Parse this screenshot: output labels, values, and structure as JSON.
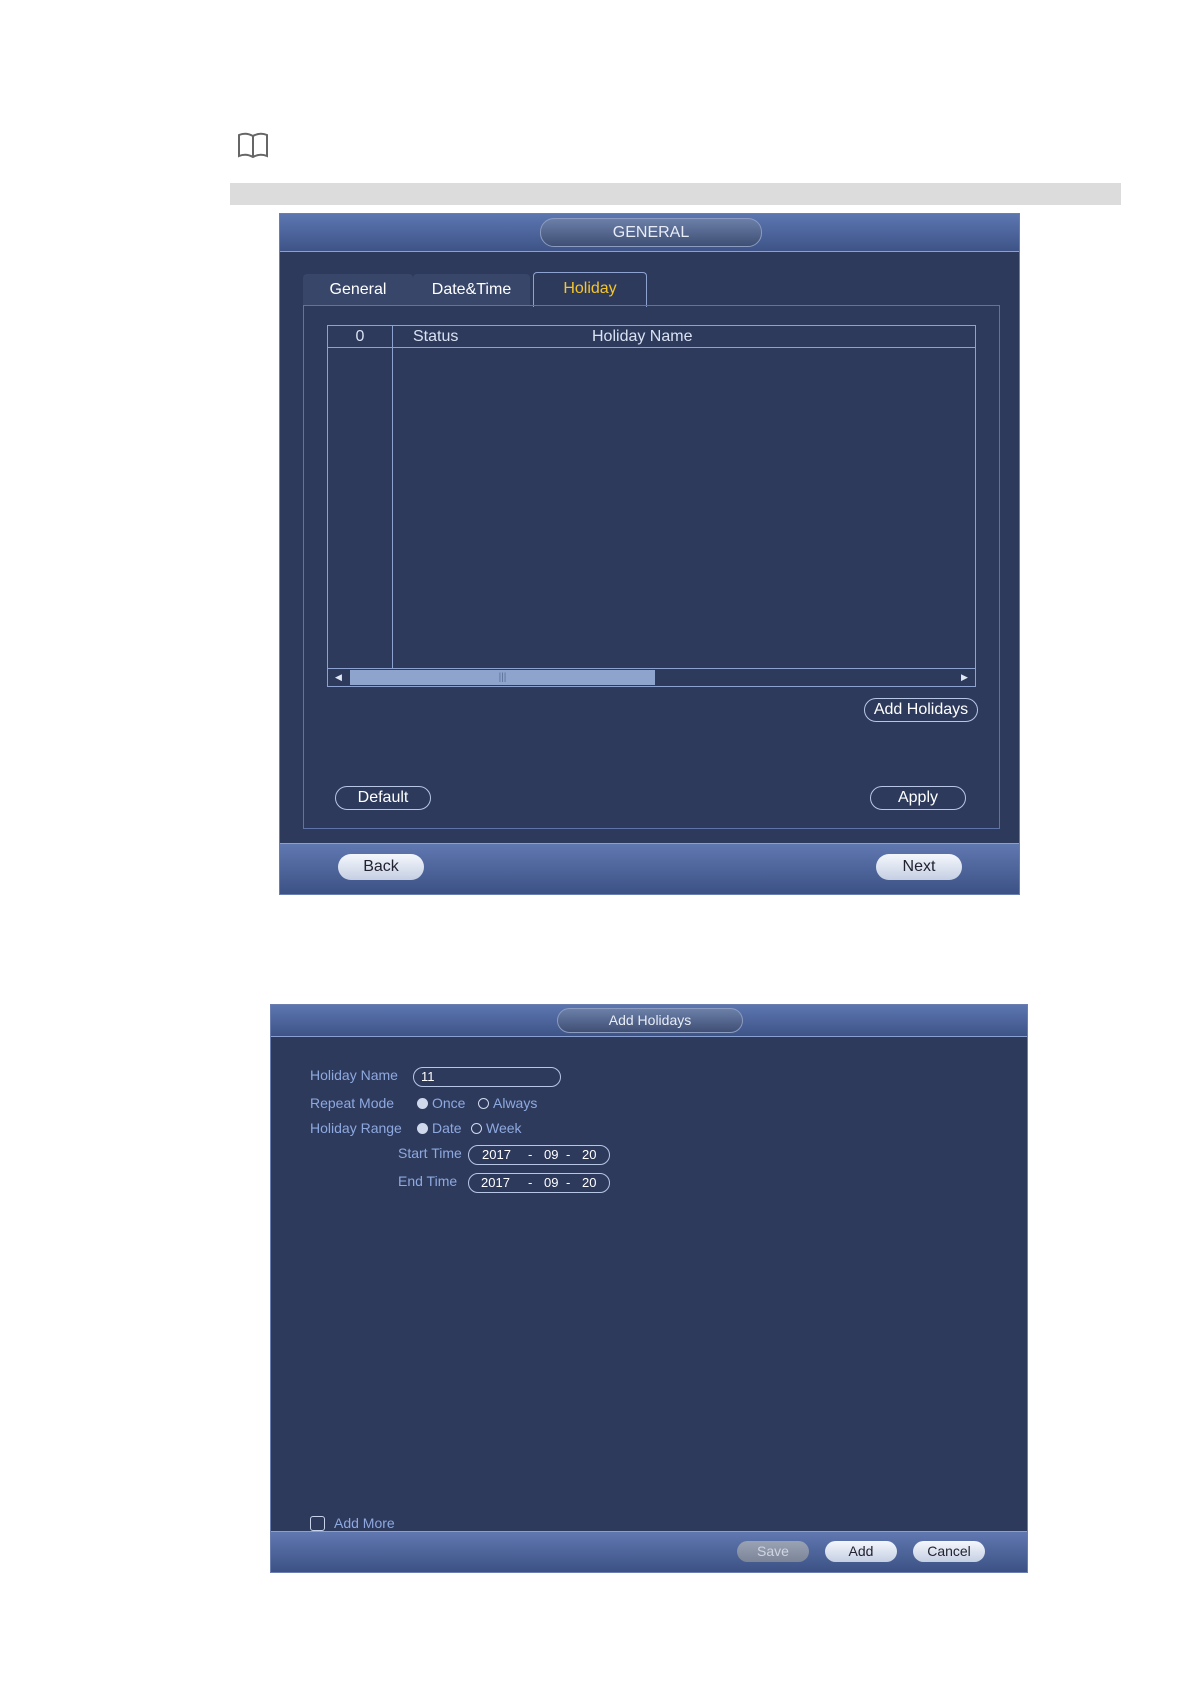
{
  "general_window": {
    "title": "GENERAL",
    "tabs": [
      {
        "label": "General",
        "active": false
      },
      {
        "label": "Date&Time",
        "active": false
      },
      {
        "label": "Holiday",
        "active": true
      }
    ],
    "table": {
      "count": "0",
      "columns": [
        "Status",
        "Holiday Name"
      ],
      "rows": []
    },
    "add_holidays_label": "Add Holidays",
    "default_label": "Default",
    "apply_label": "Apply",
    "back_label": "Back",
    "next_label": "Next"
  },
  "add_holidays_window": {
    "title": "Add Holidays",
    "holiday_name_label": "Holiday Name",
    "holiday_name_value": "11",
    "repeat_mode_label": "Repeat Mode",
    "repeat_options": [
      {
        "label": "Once",
        "selected": true
      },
      {
        "label": "Always",
        "selected": false
      }
    ],
    "holiday_range_label": "Holiday Range",
    "range_options": [
      {
        "label": "Date",
        "selected": true
      },
      {
        "label": "Week",
        "selected": false
      }
    ],
    "start_time_label": "Start Time",
    "start_time": {
      "year": "2017",
      "month": "09",
      "day": "20"
    },
    "end_time_label": "End Time",
    "end_time": {
      "year": "2017",
      "month": "09",
      "day": "20"
    },
    "date_separator": "-",
    "add_more_label": "Add More",
    "save_label": "Save",
    "add_label": "Add",
    "cancel_label": "Cancel"
  },
  "colors": {
    "panel_bg": "#2d3a5c",
    "title_bar": "#4a63a0",
    "active_tab_text": "#f5c52a",
    "label_text": "#8ea9e0"
  }
}
